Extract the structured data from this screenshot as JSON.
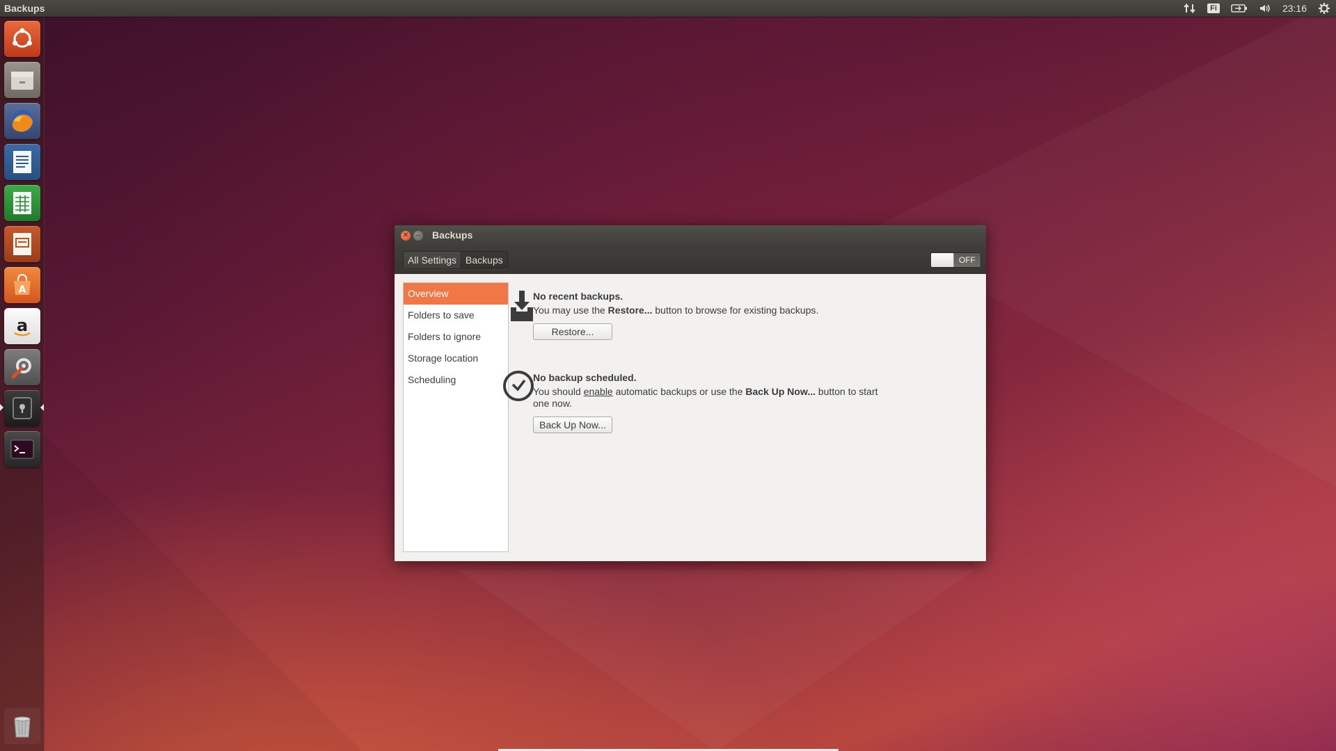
{
  "top_panel": {
    "app_title": "Backups",
    "keyboard_layout": "Fi",
    "clock": "23:16"
  },
  "launcher": {
    "items": [
      {
        "name": "dash-home",
        "color": "#dd4814"
      },
      {
        "name": "files",
        "color": "#8a847d"
      },
      {
        "name": "firefox",
        "color": "#3a5d9a"
      },
      {
        "name": "libreoffice-writer",
        "color": "#dfe7f1"
      },
      {
        "name": "libreoffice-calc",
        "color": "#2d9c3b"
      },
      {
        "name": "libreoffice-impress",
        "color": "#e8d8c8"
      },
      {
        "name": "software-center",
        "color": "#e86a2e"
      },
      {
        "name": "amazon",
        "color": "#f4f4f4"
      },
      {
        "name": "system-settings",
        "color": "#6b6b6b"
      },
      {
        "name": "backups",
        "color": "#2c2c2c"
      },
      {
        "name": "terminal",
        "color": "#2c2c2c"
      }
    ]
  },
  "window": {
    "title": "Backups",
    "breadcrumb": [
      "All Settings",
      "Backups"
    ],
    "switch_label": "OFF",
    "sidebar": [
      "Overview",
      "Folders to save",
      "Folders to ignore",
      "Storage location",
      "Scheduling"
    ],
    "restore": {
      "heading": "No recent backups.",
      "desc_pre": "You may use the ",
      "desc_bold": "Restore...",
      "desc_post": " button to browse for existing backups.",
      "button": "Restore..."
    },
    "schedule": {
      "heading": "No backup scheduled.",
      "desc_pre": "You should ",
      "desc_link": "enable",
      "desc_mid": " automatic backups or use the ",
      "desc_bold": "Back Up Now...",
      "desc_post": " button to start one now.",
      "button": "Back Up Now..."
    }
  },
  "colors": {
    "accent": "#f07746",
    "panel": "#3b3a36"
  }
}
